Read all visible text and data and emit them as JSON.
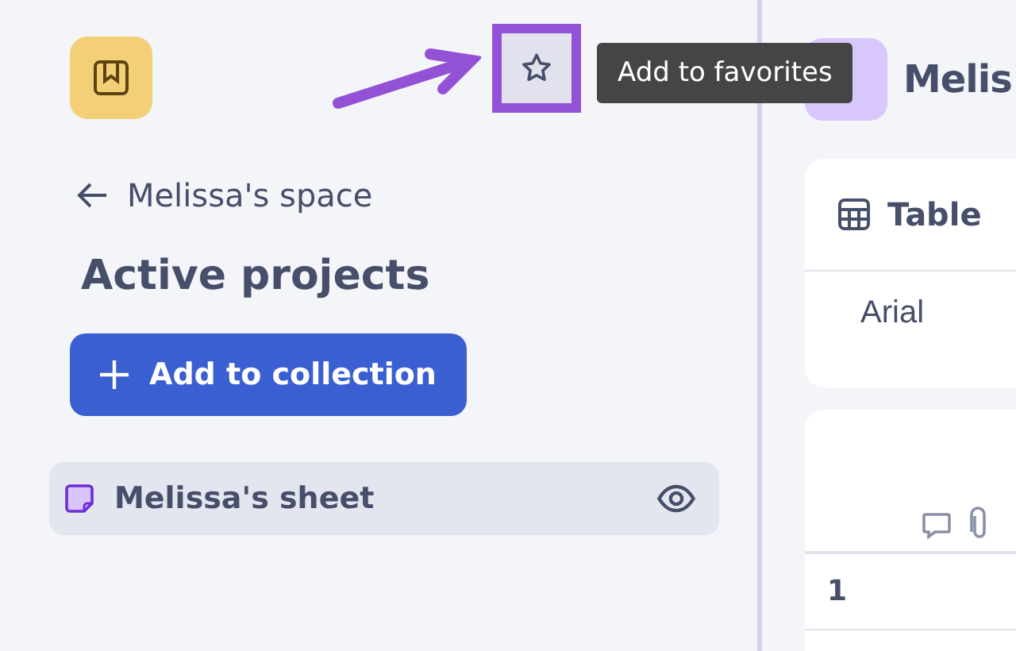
{
  "sidebar": {
    "favorite_button": {
      "highlighted": true
    },
    "tooltip": "Add to favorites",
    "back_link": "Melissa's space",
    "heading": "Active projects",
    "add_button": "Add to collection",
    "items": [
      {
        "label": "Melissa's sheet",
        "selected": true
      }
    ]
  },
  "main": {
    "title": "Melis",
    "view_selector": "Table",
    "font": "Arial",
    "rows": [
      {
        "number": "1"
      }
    ]
  }
}
